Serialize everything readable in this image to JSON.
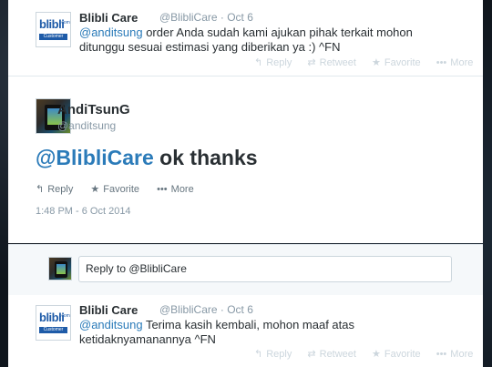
{
  "tweet_top": {
    "name": "Blibli Care",
    "handle_date": "@BlibliCare · Oct 6",
    "mention": "@anditsung",
    "text_line1": " order Anda sudah kami ajukan pihak terkait mohon",
    "text_line2": "ditunggu sesuai estimasi yang diberikan ya :) ^FN",
    "actions": {
      "reply": "Reply",
      "retweet": "Retweet",
      "favorite": "Favorite",
      "more": "More"
    }
  },
  "tweet_main": {
    "name": "AndiTsunG",
    "handle": "@anditsung",
    "mention": "@BlibliCare",
    "text": " ok thanks",
    "actions": {
      "reply": "Reply",
      "favorite": "Favorite",
      "more": "More"
    },
    "timestamp": "1:48 PM - 6 Oct 2014"
  },
  "reply_box": {
    "prefix": "Reply to ",
    "mention": "@BlibliCare"
  },
  "tweet_bottom": {
    "name": "Blibli Care",
    "handle_date": "@BlibliCare · Oct 6",
    "mention": "@anditsung",
    "text_line1": " Terima kasih kembali, mohon maaf atas",
    "text_line2": "ketidaknyamanannya ^FN",
    "actions": {
      "reply": "Reply",
      "retweet": "Retweet",
      "favorite": "Favorite",
      "more": "More"
    }
  },
  "avatar_logo": {
    "brand": "blibli",
    "suffix": ".com",
    "caption": "Customer Care"
  },
  "icons": {
    "reply": "reply-icon",
    "retweet": "retweet-icon",
    "favorite": "star-icon",
    "more": "more-dots-icon"
  },
  "colors": {
    "link": "#2b7bb9",
    "text": "#292f33",
    "muted": "#8899a6",
    "brand": "#1e5ba8"
  }
}
